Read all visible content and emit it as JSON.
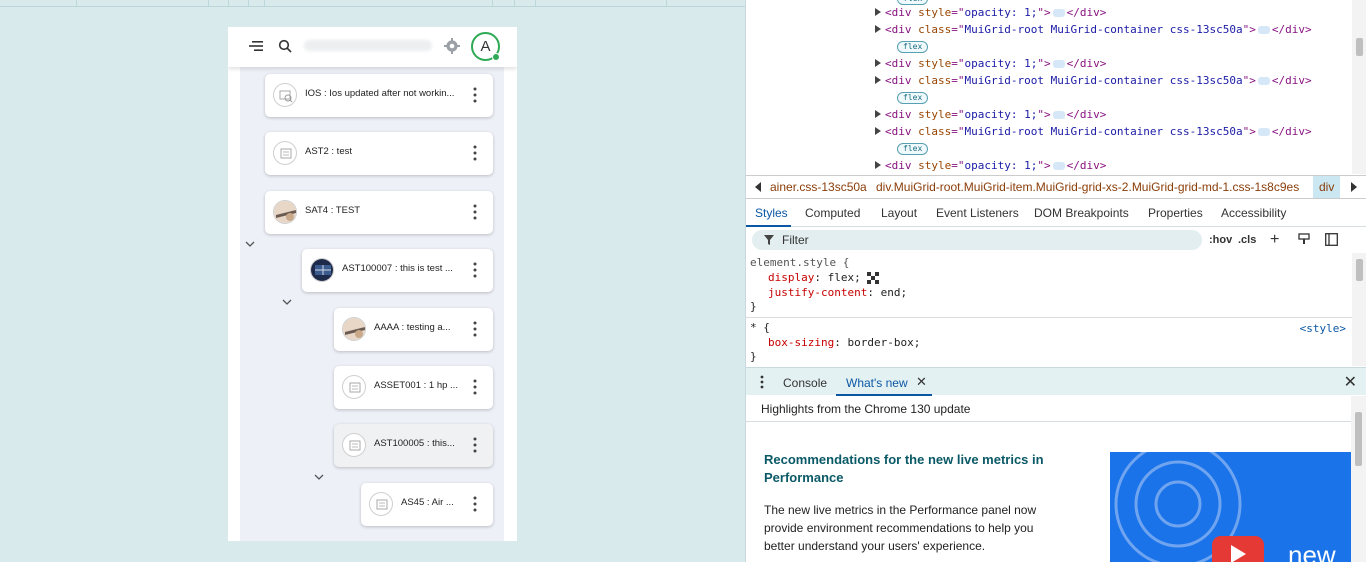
{
  "app": {
    "tree_nodes": [
      {
        "label": "IOS : Ios updated after not workin...",
        "thumb": "search-image"
      },
      {
        "label": "AST2 : test",
        "thumb": "placeholder"
      },
      {
        "label": "SAT4 : TEST",
        "thumb": "photo"
      },
      {
        "label": "AST100007 : this is test ...",
        "thumb": "photo-dark"
      },
      {
        "label": "AAAA : testing a...",
        "thumb": "photo"
      },
      {
        "label": "ASSET001 : 1 hp ...",
        "thumb": "placeholder"
      },
      {
        "label": "AST100005 : this...",
        "thumb": "placeholder"
      },
      {
        "label": "AS45 : Air ...",
        "thumb": "placeholder"
      }
    ],
    "avatar_letter": "A"
  },
  "devtools": {
    "elements": {
      "lines": [
        {
          "tag_open": "<div ",
          "attr": "style",
          "eq": "=\"",
          "val": "opacity: 1;",
          "close": "\">",
          "end": "</div>"
        },
        {
          "tag_open": "<div ",
          "attr": "class",
          "eq": "=\"",
          "val": "MuiGrid-root MuiGrid-container css-13sc50a",
          "close": "\">",
          "end": "</div>"
        },
        {
          "tag_open": "<div ",
          "attr": "style",
          "eq": "=\"",
          "val": "opacity: 1;",
          "close": "\">",
          "end": "</div>"
        },
        {
          "tag_open": "<div ",
          "attr": "class",
          "eq": "=\"",
          "val": "MuiGrid-root MuiGrid-container css-13sc50a",
          "close": "\">",
          "end": "</div>"
        },
        {
          "tag_open": "<div ",
          "attr": "style",
          "eq": "=\"",
          "val": "opacity: 1;",
          "close": "\">",
          "end": "</div>"
        },
        {
          "tag_open": "<div ",
          "attr": "class",
          "eq": "=\"",
          "val": "MuiGrid-root MuiGrid-container css-13sc50a",
          "close": "\">",
          "end": "</div>"
        },
        {
          "tag_open": "<div ",
          "attr": "style",
          "eq": "=\"",
          "val": "opacity: 1;",
          "close": "\">",
          "end": "</div>"
        }
      ],
      "flex_badge": "flex"
    },
    "breadcrumbs": [
      "ainer.css-13sc50a",
      "div.MuiGrid-root.MuiGrid-item.MuiGrid-grid-xs-2.MuiGrid-grid-md-1.css-1s8c9es",
      "div"
    ],
    "tabs": [
      "Styles",
      "Computed",
      "Layout",
      "Event Listeners",
      "DOM Breakpoints",
      "Properties",
      "Accessibility"
    ],
    "filter_placeholder": "Filter",
    "hov": ":hov",
    "cls": ".cls",
    "styles": {
      "rule1_selector": "element.style {",
      "rule1_prop1": "display",
      "rule1_val1": "flex;",
      "rule1_prop2": "justify-content",
      "rule1_val2": "end;",
      "close_brace": "}",
      "rule2_selector": "* {",
      "rule2_prop1": "box-sizing",
      "rule2_val1": "border-box;",
      "rule2_source": "<style>"
    },
    "drawer": {
      "tabs": [
        "Console",
        "What's new"
      ],
      "whats_new_header": "Highlights from the Chrome 130 update",
      "card_title": "Recommendations for the new live metrics in Performance",
      "card_text": "The new live metrics in the Performance panel now provide environment recommendations to help you better understand your users' experience.",
      "thumb_text": "new"
    },
    "colors": {
      "accent": "#0b57a5",
      "title_teal": "#0a5966",
      "online_green": "#2eaa55"
    }
  }
}
